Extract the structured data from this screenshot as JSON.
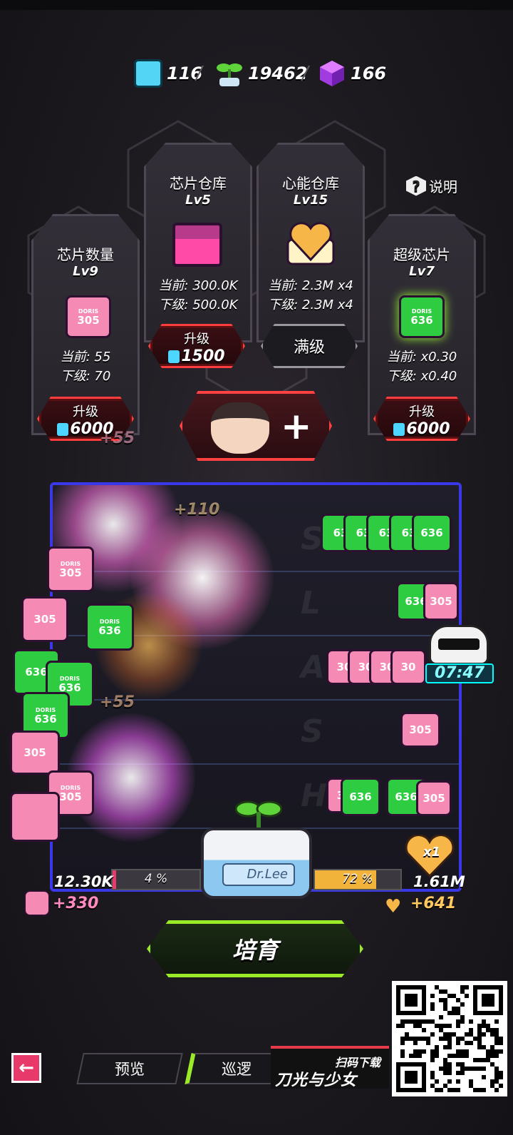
{
  "resources": {
    "chips": "116",
    "sprouts": "19462",
    "cubes": "166"
  },
  "help": {
    "label": "说明"
  },
  "cards": [
    {
      "title": "芯片数量",
      "level": "Lv9",
      "current": "当前: 55",
      "next": "下级: 70",
      "button_top": "升级",
      "button_cost": "6000",
      "chip_code": "305"
    },
    {
      "title": "芯片仓库",
      "level": "Lv5",
      "current": "当前: 300.0K",
      "next": "下级: 500.0K",
      "button_top": "升级",
      "button_cost": "1500"
    },
    {
      "title": "心能仓库",
      "level": "Lv15",
      "current": "当前: 2.3M x4",
      "next": "下级: 2.3M x4",
      "button_label": "满级"
    },
    {
      "title": "超级芯片",
      "level": "Lv7",
      "current": "当前: x0.30",
      "next": "下级: x0.40",
      "button_top": "升级",
      "button_cost": "6000",
      "chip_code": "636"
    }
  ],
  "chip_brand": "DORIS",
  "arena": {
    "timer": "07:47",
    "left_progress_pct": 4,
    "left_progress_label": "4 %",
    "right_progress_pct": 72,
    "right_progress_label": "72 %",
    "pod_label": "Dr.Lee",
    "chip_total": "12.30K",
    "chip_gain": "+330",
    "heart_total": "1.61M",
    "heart_gain": "+641",
    "multiplier": "x1",
    "float_texts": [
      "+55",
      "+110",
      "+55"
    ]
  },
  "main_button": {
    "label": "培育"
  },
  "nav": {
    "preview": "预览",
    "patrol": "巡逻",
    "promo_line1": "扫码下载",
    "promo_line2": "刀光与少女"
  },
  "colors": {
    "accent_red": "#ff3d3d",
    "accent_green": "#9aea27",
    "arena_border": "#3a38e8",
    "chip_pink": "#f58ab4",
    "chip_green": "#2ecc40"
  }
}
